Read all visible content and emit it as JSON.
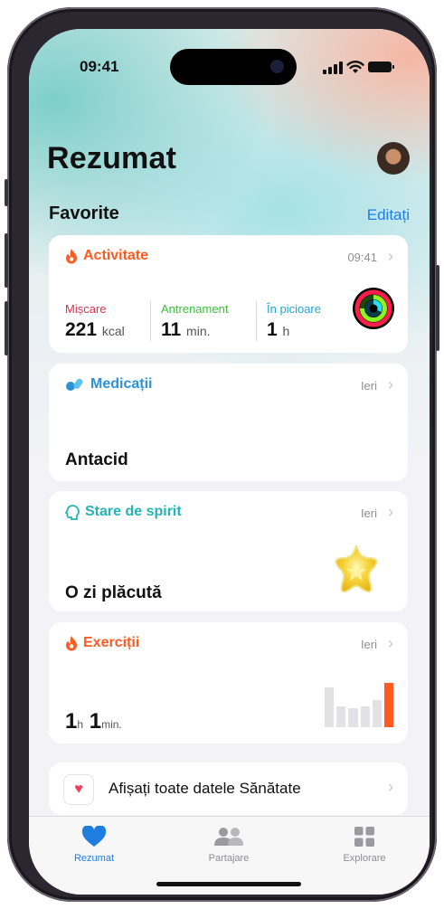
{
  "status_bar": {
    "time": "09:41"
  },
  "header": {
    "title": "Rezumat"
  },
  "favorites": {
    "title": "Favorite",
    "edit_label": "Editați"
  },
  "activity": {
    "title": "Activitate",
    "time": "09:41",
    "metrics": [
      {
        "label": "Mișcare",
        "value": "221",
        "unit": "kcal",
        "color": "#e0304e"
      },
      {
        "label": "Antrenament",
        "value": "11",
        "unit": "min.",
        "color": "#36c43a"
      },
      {
        "label": "În picioare",
        "value": "1",
        "unit": "h",
        "color": "#1ea5d8"
      }
    ],
    "accent": "#ff5a1f"
  },
  "medications": {
    "title": "Medicații",
    "time": "Ieri",
    "value": "Antacid",
    "accent": "#2e92d9"
  },
  "mood": {
    "title": "Stare de spirit",
    "time": "Ieri",
    "value": "O zi plăcută",
    "accent": "#22b5b5"
  },
  "exercise": {
    "title": "Exerciții",
    "time": "Ieri",
    "hours": "1",
    "hours_unit": "h",
    "minutes": "1",
    "minutes_unit": "min.",
    "accent": "#ff5a1f"
  },
  "show_all": {
    "label": "Afișați toate datele Sănătate"
  },
  "tabs": [
    {
      "label": "Rezumat",
      "icon": "heart-icon",
      "active": true
    },
    {
      "label": "Partajare",
      "icon": "people-icon",
      "active": false
    },
    {
      "label": "Explorare",
      "icon": "grid-icon",
      "active": false
    }
  ],
  "colors": {
    "link": "#1e7de0",
    "active_tab": "#1e7de0",
    "inactive_tab": "#8e8e93"
  }
}
